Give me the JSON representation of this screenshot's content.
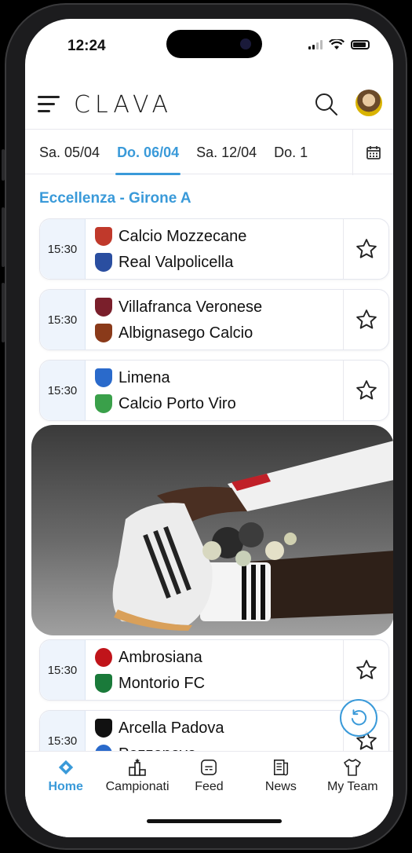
{
  "status": {
    "time": "12:24"
  },
  "header": {
    "logo": "CLAVA"
  },
  "dates": [
    {
      "label": "Sa. 05/04",
      "active": false
    },
    {
      "label": "Do. 06/04",
      "active": true
    },
    {
      "label": "Sa. 12/04",
      "active": false
    },
    {
      "label": "Do. 1",
      "active": false
    }
  ],
  "section_title": "Eccellenza - Girone A",
  "matches": [
    {
      "time": "15:30",
      "home": "Calcio Mozzecane",
      "away": "Real Valpolicella",
      "home_color": "#c0392b",
      "away_color": "#2a4ea0"
    },
    {
      "time": "15:30",
      "home": "Villafranca Veronese",
      "away": "Albignasego Calcio",
      "home_color": "#7a1f2b",
      "away_color": "#8a3a1a"
    },
    {
      "time": "15:30",
      "home": "Limena",
      "away": "Calcio Porto Viro",
      "home_color": "#2a6acb",
      "away_color": "#3aa04a"
    },
    {
      "time": "15:30",
      "home": "Ambrosiana",
      "away": "Montorio FC",
      "home_color": "#c0141a",
      "away_color": "#1a7a3a"
    },
    {
      "time": "15:30",
      "home": "Arcella Padova",
      "away": "Pozzonovo",
      "home_color": "#111111",
      "away_color": "#2a6acb"
    }
  ],
  "tabs": [
    {
      "label": "Home",
      "icon": "home-icon",
      "active": true
    },
    {
      "label": "Campionati",
      "icon": "trophy-icon",
      "active": false
    },
    {
      "label": "Feed",
      "icon": "feed-icon",
      "active": false
    },
    {
      "label": "News",
      "icon": "news-icon",
      "active": false
    },
    {
      "label": "My Team",
      "icon": "shirt-icon",
      "active": false
    }
  ],
  "colors": {
    "accent": "#3a9ad9",
    "time_box": "#eef4fc"
  }
}
